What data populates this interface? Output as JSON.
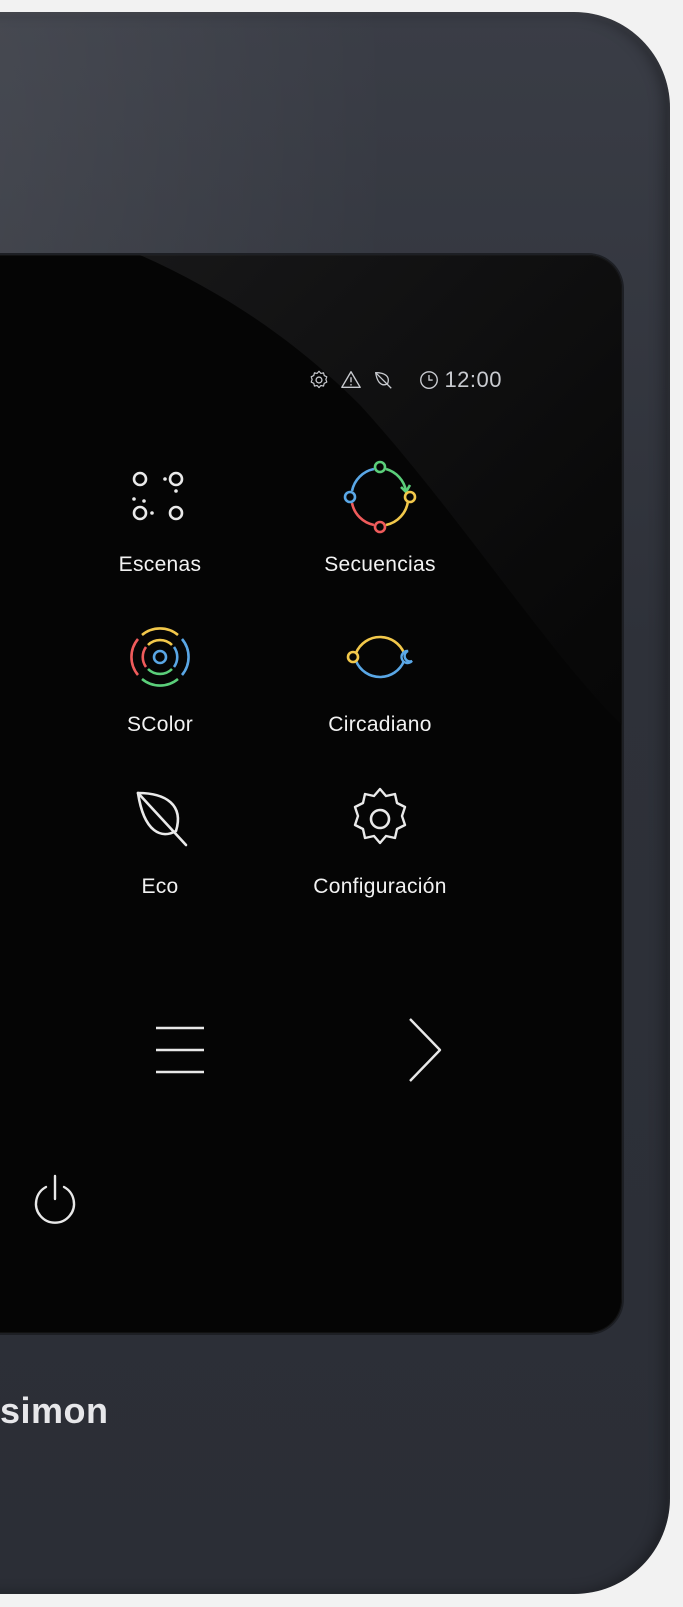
{
  "status_bar": {
    "icons": [
      "gear-outline-icon",
      "warning-triangle-icon",
      "eco-leaf-icon",
      "clock-icon"
    ],
    "time": "12:00"
  },
  "menu": {
    "items": [
      {
        "label": "Escenas",
        "icon": "scenes-dots-icon"
      },
      {
        "label": "Secuencias",
        "icon": "sequence-cycle-icon"
      },
      {
        "label": "SColor",
        "icon": "scolor-rings-icon"
      },
      {
        "label": "Circadiano",
        "icon": "circadian-icon"
      },
      {
        "label": "Eco",
        "icon": "leaf-icon"
      },
      {
        "label": "Configuración",
        "icon": "gear-icon"
      }
    ]
  },
  "navigation": {
    "menu_icon": "hamburger-icon",
    "next_icon": "chevron-right-icon",
    "power_icon": "power-icon"
  },
  "brand": {
    "text": "simon"
  },
  "colors": {
    "screen_bg": "#050505",
    "device_body": "#2e3139",
    "text": "#f2f2f2",
    "accent_blue": "#5aa7e6",
    "accent_green": "#5bcf7a",
    "accent_yellow": "#f2c84b",
    "accent_red": "#ef5b5b"
  }
}
